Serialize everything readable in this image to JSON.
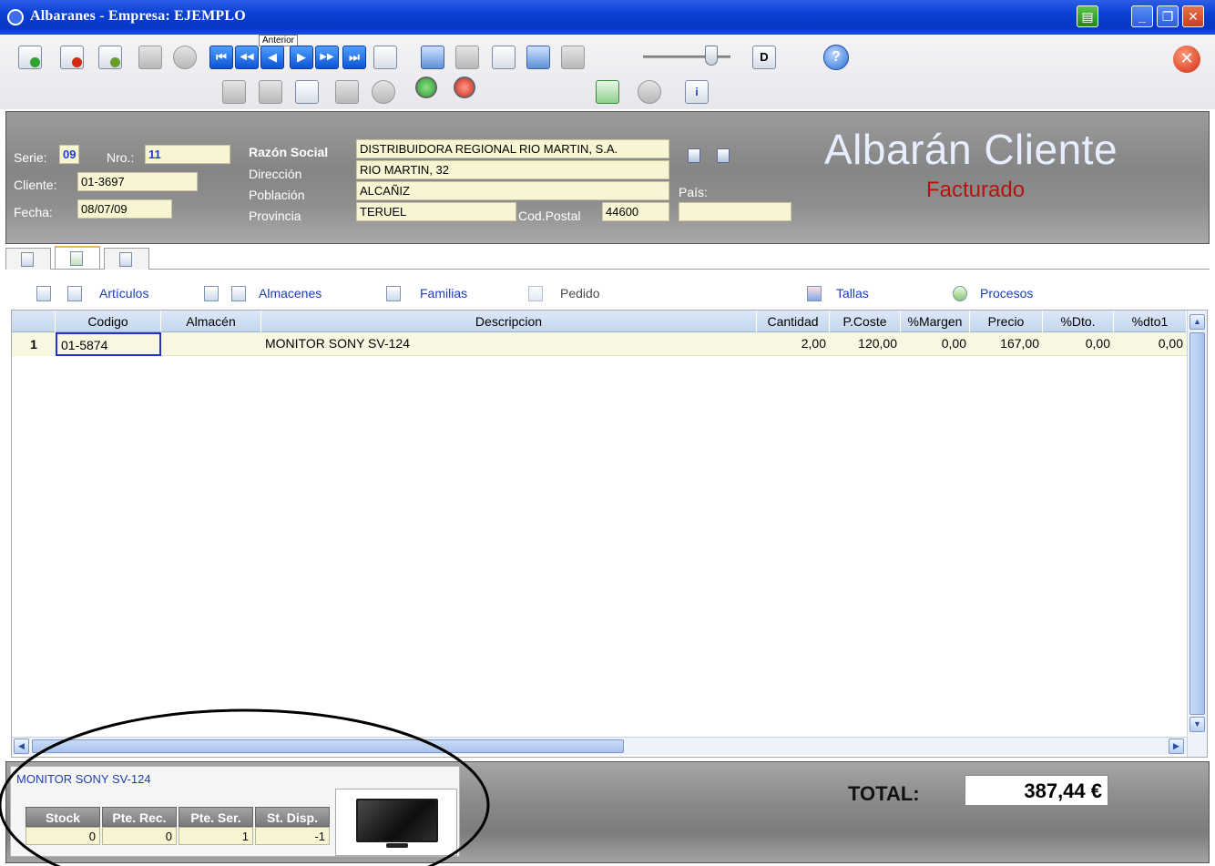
{
  "window": {
    "title": "Albaranes - Empresa: EJEMPLO",
    "minimize_glyph": "_",
    "restore_glyph": "❐",
    "close_glyph": "✕"
  },
  "toolbar": {
    "tooltip": "Anterior",
    "nav_first": "⏮",
    "nav_prev_page": "◀◀",
    "nav_prev": "◀",
    "nav_next": "▶",
    "nav_next_page": "▶▶",
    "nav_last": "⏭",
    "d_label": "D",
    "help_glyph": "?",
    "exit_glyph": "✕",
    "info_glyph": "i",
    "slider_level": 0.78
  },
  "header": {
    "labels": {
      "serie": "Serie:",
      "nro": "Nro.:",
      "cliente": "Cliente:",
      "fecha": "Fecha:",
      "razon_social": "Razón Social",
      "direccion": "Dirección",
      "poblacion": "Población",
      "provincia": "Provincia",
      "cod_postal": "Cod.Postal",
      "pais": "País:"
    },
    "values": {
      "serie": "09",
      "nro": "11",
      "cliente": "01-3697",
      "fecha": "08/07/09",
      "razon_social": "DISTRIBUIDORA REGIONAL RIO MARTIN, S.A.",
      "direccion": "RIO MARTIN, 32",
      "poblacion": "ALCAÑIZ",
      "provincia": "TERUEL",
      "cod_postal": "44600",
      "pais": ""
    },
    "doc_title": "Albarán Cliente",
    "doc_status": "Facturado"
  },
  "links": {
    "articulos": "Artículos",
    "almacenes": "Almacenes",
    "familias": "Familias",
    "pedido": "Pedido",
    "tallas": "Tallas",
    "procesos": "Procesos"
  },
  "grid": {
    "columns": [
      "Codigo",
      "Almacén",
      "Descripcion",
      "Cantidad",
      "P.Coste",
      "%Margen",
      "Precio",
      "%Dto.",
      "%dto1"
    ],
    "rows": [
      {
        "num": "1",
        "codigo": "01-5874",
        "almacen": "",
        "descripcion": "MONITOR SONY  SV-124",
        "cantidad": "2,00",
        "p_coste": "120,00",
        "margen": "0,00",
        "precio": "167,00",
        "dto": "0,00",
        "dto1": "0,00"
      }
    ],
    "scroll_up": "▲",
    "scroll_down": "▼",
    "scroll_left": "◀",
    "scroll_right": "▶"
  },
  "product": {
    "name": "MONITOR SONY  SV-124",
    "stock_headers": [
      "Stock",
      "Pte. Rec.",
      "Pte. Ser.",
      "St. Disp."
    ],
    "stock_values": [
      "0",
      "0",
      "1",
      "-1"
    ]
  },
  "total": {
    "label": "TOTAL:",
    "value": "387,44 €"
  },
  "colors": {
    "title_bar": "#0a3fd4",
    "link": "#1c3fb4",
    "status_red": "#b5140c",
    "field_bg": "#f8f6d2",
    "grid_header": "#c5d7ee"
  }
}
